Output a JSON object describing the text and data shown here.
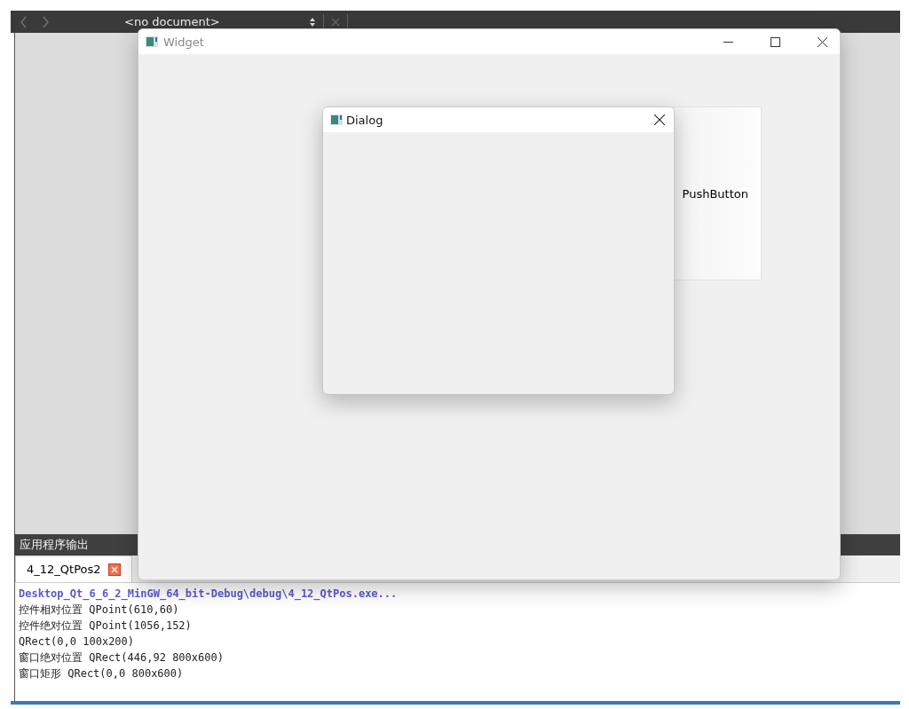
{
  "ide": {
    "toolbar": {
      "document": "<no document>"
    },
    "output_pane": {
      "title": "应用程序输出",
      "tabs": [
        {
          "label": "4_12_QtPos2",
          "selected": true
        }
      ],
      "lines": [
        {
          "kind": "path",
          "text": "Desktop_Qt_6_6_2_MinGW_64_bit-Debug\\debug\\4_12_QtPos.exe..."
        },
        {
          "kind": "plain",
          "text": "控件相对位置 QPoint(610,60)"
        },
        {
          "kind": "plain",
          "text": "控件绝对位置 QPoint(1056,152)"
        },
        {
          "kind": "plain",
          "text": "QRect(0,0 100x200)"
        },
        {
          "kind": "plain",
          "text": "窗口绝对位置 QRect(446,92 800x600)"
        },
        {
          "kind": "plain",
          "text": "窗口矩形 QRect(0,0 800x600)"
        }
      ]
    }
  },
  "widget_window": {
    "title": "Widget",
    "push_button": "PushButton"
  },
  "dialog": {
    "title": "Dialog"
  }
}
